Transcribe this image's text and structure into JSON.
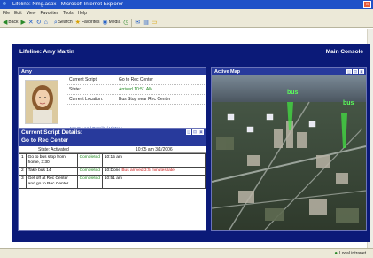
{
  "browser": {
    "title": "Lifeline: Nmg.aspx - Microsoft Internet Explorer",
    "menu": [
      "File",
      "Edit",
      "View",
      "Favorites",
      "Tools",
      "Help"
    ],
    "toolbar": {
      "back": "Back",
      "search": "Search",
      "favorites": "Favorites",
      "media": "Media"
    },
    "status": {
      "zone": "Local intranet"
    }
  },
  "app": {
    "title": "Lifeline: Amy Martin",
    "main_console": "Main Console"
  },
  "amy_panel": {
    "header": "Amy",
    "rows": [
      {
        "label": "Current Script:",
        "value": "Go to Rec Center"
      },
      {
        "label": "State:",
        "value": "Arrived 10:51 AM"
      },
      {
        "label": "Current Location:",
        "value": "Bus Stop near Rec Center"
      }
    ],
    "link": "Amy's Log / Details / History"
  },
  "script_panel": {
    "title_line1": "Current Script Details:",
    "title_line2": "Go to Rec Center",
    "state": "State: Activated",
    "date": "10:05 am 3/1/2006",
    "steps": [
      {
        "num": "1",
        "task": "Go to bus stop from home, 3:30",
        "status": "Completed",
        "time": "10:15 am",
        "note": ""
      },
      {
        "num": "2",
        "task": "Take bus 14",
        "status": "Completed",
        "time": "10:Done ",
        "note": "Bus arrived 3:5 minutes late"
      },
      {
        "num": "3",
        "task": "Get off at Rec Center and go to Rec Center",
        "status": "Completed",
        "time": "10:51 am",
        "note": ""
      }
    ]
  },
  "map_panel": {
    "header": "Active Map",
    "bus_labels": [
      "bus",
      "bus"
    ]
  }
}
